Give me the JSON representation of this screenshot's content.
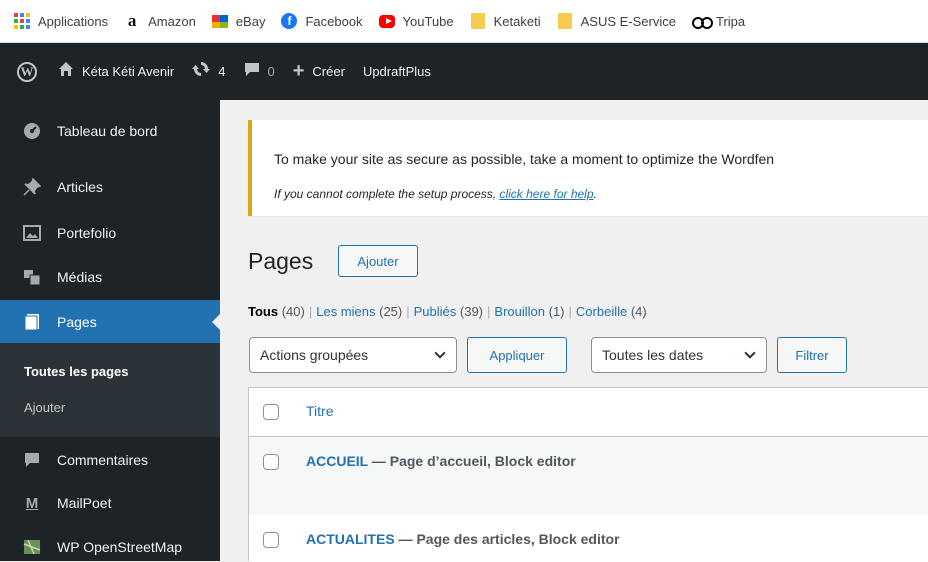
{
  "bookmarks": [
    {
      "label": "Applications",
      "icon": "apps-grid-icon"
    },
    {
      "label": "Amazon",
      "icon": "amazon-icon"
    },
    {
      "label": "eBay",
      "icon": "ebay-icon"
    },
    {
      "label": "Facebook",
      "icon": "facebook-icon"
    },
    {
      "label": "YouTube",
      "icon": "youtube-icon"
    },
    {
      "label": "Ketaketi",
      "icon": "folder-icon"
    },
    {
      "label": "ASUS E-Service",
      "icon": "folder-icon"
    },
    {
      "label": "Tripa",
      "icon": "tripadvisor-icon"
    }
  ],
  "adminbar": {
    "site_name": "Kéta Kéti Avenir",
    "updates_count": "4",
    "comments_count": "0",
    "new_label": "Créer",
    "plugin_label": "UpdraftPlus"
  },
  "sidebar": {
    "items": [
      {
        "label": "Tableau de bord",
        "icon": "dashboard-icon"
      },
      {
        "label": "Articles",
        "icon": "pushpin-icon"
      },
      {
        "label": "Portefolio",
        "icon": "image-icon"
      },
      {
        "label": "Médias",
        "icon": "media-icon"
      },
      {
        "label": "Pages",
        "icon": "page-icon"
      },
      {
        "label": "Commentaires",
        "icon": "comment-icon"
      },
      {
        "label": "MailPoet",
        "icon": "mailpoet-icon"
      },
      {
        "label": "WP OpenStreetMap",
        "icon": "map-icon"
      }
    ],
    "submenu": [
      "Toutes les pages",
      "Ajouter"
    ]
  },
  "notice": {
    "text": "To make your site as secure as possible, take a moment to optimize the Wordfen",
    "help_prefix": "If you cannot complete the setup process, ",
    "help_link": "click here for help",
    "help_suffix": "."
  },
  "pages": {
    "title": "Pages",
    "add_button": "Ajouter",
    "filters": [
      {
        "label": "Tous",
        "count": "(40)"
      },
      {
        "label": "Les miens",
        "count": "(25)"
      },
      {
        "label": "Publiés",
        "count": "(39)"
      },
      {
        "label": "Brouillon",
        "count": "(1)"
      },
      {
        "label": "Corbeille",
        "count": "(4)"
      }
    ],
    "separator": "|",
    "bulk_actions": "Actions groupées",
    "apply_button": "Appliquer",
    "dates_filter": "Toutes les dates",
    "filter_button": "Filtrer",
    "column_title": "Titre",
    "rows": [
      {
        "title": "ACCUEIL",
        "state": " — Page d’accueil, Block editor"
      },
      {
        "title": "ACTUALITES",
        "state": " — Page des articles, Block editor"
      }
    ]
  },
  "colors": {
    "admin_dark": "#1d2327",
    "accent": "#2271b1",
    "notice_border": "#dba617"
  }
}
